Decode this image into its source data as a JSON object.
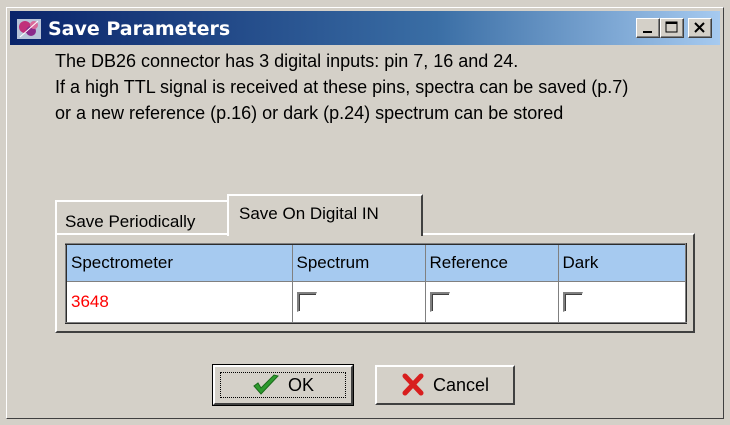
{
  "window": {
    "title": "Save Parameters",
    "icons": {
      "app": "app-icon",
      "minimize": "minimize-icon",
      "maximize": "maximize-icon",
      "close": "close-icon"
    }
  },
  "info": {
    "line1": "The DB26 connector has 3 digital inputs: pin 7, 16 and 24.",
    "line2": "If a high TTL signal is received at these pins, spectra can be saved (p.7)",
    "line3": "or a new reference (p.16) or dark (p.24) spectrum can be stored"
  },
  "tabs": [
    {
      "label": "Save Periodically",
      "active": false
    },
    {
      "label": "Save On Digital IN",
      "active": true
    }
  ],
  "grid": {
    "columns": [
      "Spectrometer",
      "Spectrum",
      "Reference",
      "Dark"
    ],
    "rows": [
      {
        "spectrometer": "3648",
        "spectrum": false,
        "reference": false,
        "dark": false
      }
    ]
  },
  "buttons": {
    "ok": {
      "label": "OK",
      "icon": "checkmark-icon"
    },
    "cancel": {
      "label": "Cancel",
      "icon": "x-icon"
    }
  },
  "colors": {
    "header_bg": "#a6caf0",
    "spectrometer_text": "#ff0000",
    "title_gradient_start": "#0a246a",
    "title_gradient_end": "#a6caf0"
  }
}
